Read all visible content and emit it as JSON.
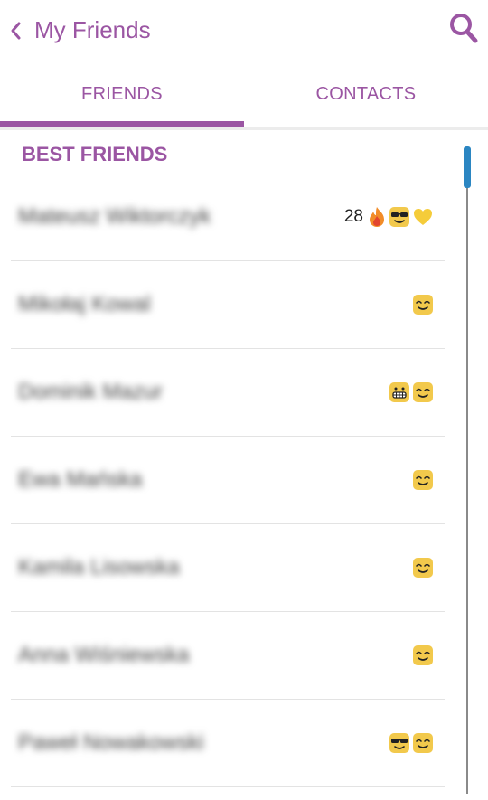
{
  "header": {
    "back_icon": "chevron-left-icon",
    "title": "My Friends",
    "search_icon": "search-icon"
  },
  "tabs": [
    {
      "label": "FRIENDS",
      "selected": true
    },
    {
      "label": "CONTACTS",
      "selected": false
    }
  ],
  "colors": {
    "accent": "#9b56a3",
    "scroll_thumb": "#2b86c2",
    "emoji_yellow": "#f2c94c",
    "divider": "#e3e3e3"
  },
  "section": {
    "title": "BEST FRIENDS"
  },
  "friends": [
    {
      "name": "Mateusz Wiktorczyk",
      "streak": "28",
      "badges": [
        "fire-icon",
        "sunglasses-face-icon",
        "yellow-heart-icon"
      ]
    },
    {
      "name": "Mikołaj Kowal",
      "streak": "",
      "badges": [
        "smiling-face-icon"
      ]
    },
    {
      "name": "Dominik Mazur",
      "streak": "",
      "badges": [
        "grimacing-face-icon",
        "smiling-face-icon"
      ]
    },
    {
      "name": "Ewa Mańska",
      "streak": "",
      "badges": [
        "smiling-face-icon"
      ]
    },
    {
      "name": "Kamila Lisowska",
      "streak": "",
      "badges": [
        "smiling-face-icon"
      ]
    },
    {
      "name": "Anna Wiśniewska",
      "streak": "",
      "badges": [
        "smiling-face-icon"
      ]
    },
    {
      "name": "Paweł Nowakowski",
      "streak": "",
      "badges": [
        "sunglasses-face-icon",
        "smiling-face-icon"
      ]
    }
  ]
}
